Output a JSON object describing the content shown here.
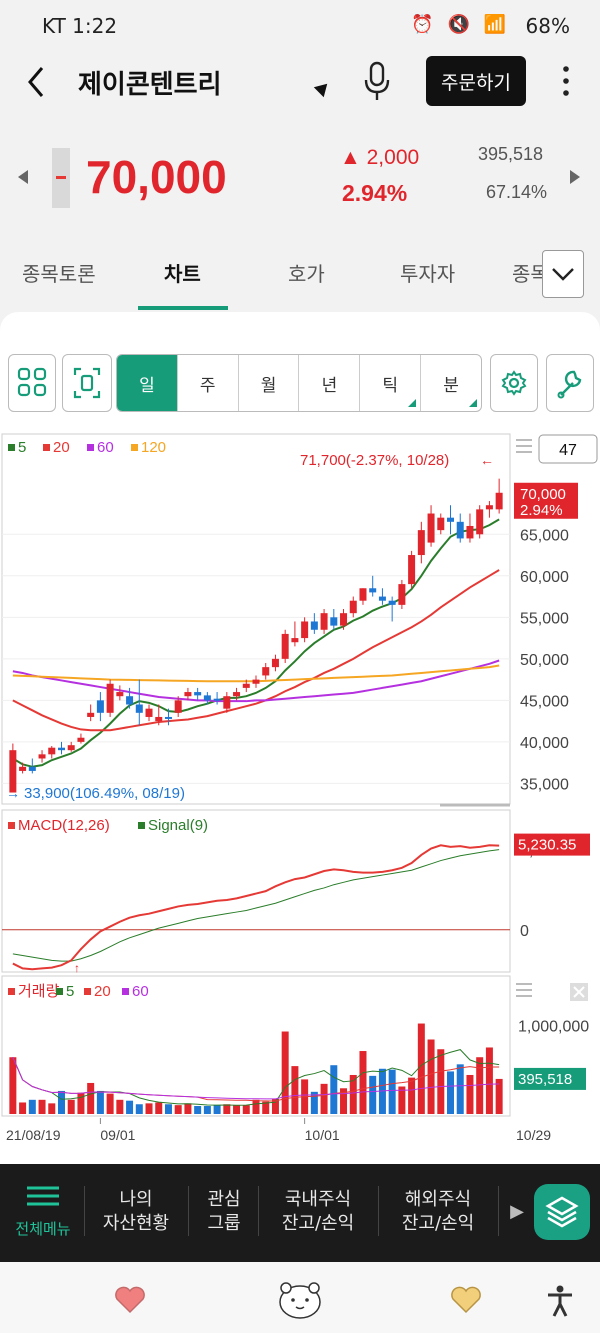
{
  "status": {
    "time": "KT 1:22",
    "battery": "68%"
  },
  "header": {
    "title": "제이콘텐트리",
    "order_label": "주문하기"
  },
  "quote": {
    "price": "70,000",
    "change": "2,000",
    "change_pct": "2.94%",
    "volume": "395,518",
    "turnover": "67.14%"
  },
  "tabs": [
    "종목토론",
    "차트",
    "호가",
    "투자자",
    "종목"
  ],
  "periods": [
    "일",
    "주",
    "월",
    "년",
    "틱",
    "분"
  ],
  "chart_data": [
    {
      "type": "line",
      "panel": "price",
      "legend": [
        "5",
        "20",
        "60",
        "120"
      ],
      "legend_colors": [
        "#2a7d2a",
        "#e53935",
        "#b531e0",
        "#f5a623"
      ],
      "y_ticks": [
        "35,000",
        "40,000",
        "45,000",
        "50,000",
        "55,000",
        "60,000",
        "65,000"
      ],
      "x_labels": [
        "21/08/19",
        "09/01",
        "10/01",
        "10/29"
      ],
      "ylim": [
        33000,
        72500
      ],
      "high_annotation": "71,700(-2.37%, 10/28)",
      "low_annotation": "33,900(106.49%, 08/19)",
      "current_price": "70,000",
      "current_pct": "2.94%",
      "visible_count": "47",
      "candles": [
        [
          33900,
          39800,
          36000,
          39000
        ],
        [
          36500,
          37500,
          36200,
          37000
        ],
        [
          37000,
          38000,
          36200,
          36500
        ],
        [
          38000,
          39000,
          37500,
          38500
        ],
        [
          38500,
          39500,
          38000,
          39300
        ],
        [
          39300,
          40000,
          38500,
          39000
        ],
        [
          39000,
          40000,
          38800,
          39600
        ],
        [
          40000,
          41000,
          39800,
          40500
        ],
        [
          43000,
          44500,
          42500,
          43500
        ],
        [
          45000,
          46000,
          42500,
          43500
        ],
        [
          43500,
          47500,
          43000,
          47000
        ],
        [
          45500,
          46800,
          45000,
          46000
        ],
        [
          45500,
          46500,
          44000,
          44500
        ],
        [
          44500,
          47500,
          42000,
          43500
        ],
        [
          43000,
          44500,
          42500,
          44000
        ],
        [
          42500,
          44500,
          42000,
          43000
        ],
        [
          43000,
          44000,
          42000,
          42800
        ],
        [
          43500,
          45500,
          43000,
          45000
        ],
        [
          45500,
          46500,
          45000,
          46000
        ],
        [
          46000,
          46500,
          45000,
          45600
        ],
        [
          45600,
          46000,
          44500,
          45000
        ],
        [
          45200,
          46000,
          44500,
          45000
        ],
        [
          44000,
          46000,
          43500,
          45500
        ],
        [
          45500,
          46500,
          45000,
          46000
        ],
        [
          46500,
          47500,
          46000,
          47000
        ],
        [
          47000,
          48000,
          46500,
          47500
        ],
        [
          48000,
          49500,
          47500,
          49000
        ],
        [
          49000,
          50500,
          48500,
          50000
        ],
        [
          50000,
          53500,
          49500,
          53000
        ],
        [
          52000,
          54500,
          51500,
          52500
        ],
        [
          52500,
          55000,
          52000,
          54500
        ],
        [
          54500,
          55500,
          53000,
          53500
        ],
        [
          53500,
          56000,
          53000,
          55500
        ],
        [
          55000,
          56000,
          53500,
          54000
        ],
        [
          54000,
          56000,
          53500,
          55500
        ],
        [
          55500,
          57500,
          55000,
          57000
        ],
        [
          57000,
          58500,
          56500,
          58500
        ],
        [
          58500,
          60000,
          57500,
          58000
        ],
        [
          57500,
          58500,
          56500,
          57000
        ],
        [
          57000,
          57500,
          54500,
          56500
        ],
        [
          56500,
          59500,
          56000,
          59000
        ],
        [
          59000,
          63000,
          58500,
          62500
        ],
        [
          62500,
          66500,
          61500,
          65500
        ],
        [
          64000,
          68500,
          63500,
          67500
        ],
        [
          65500,
          67500,
          65000,
          67000
        ],
        [
          67000,
          68500,
          65000,
          66500
        ],
        [
          66500,
          67500,
          64000,
          64500
        ],
        [
          64500,
          67500,
          64000,
          66000
        ],
        [
          65000,
          68500,
          64500,
          68000
        ],
        [
          68000,
          69000,
          67000,
          68500
        ],
        [
          68000,
          71700,
          67500,
          70000
        ]
      ],
      "ma": {
        "ma5": [
          38000,
          37300,
          37000,
          37200,
          37800,
          38200,
          38600,
          39200,
          40200,
          41100,
          42200,
          43400,
          44400,
          44900,
          44700,
          44300,
          43700,
          43600,
          43900,
          44300,
          44600,
          45000,
          45300,
          45300,
          45500,
          45900,
          46500,
          47300,
          48600,
          49700,
          50900,
          51900,
          52700,
          53500,
          53900,
          54600,
          55100,
          55800,
          56300,
          56700,
          57300,
          58400,
          60000,
          61800,
          63300,
          64700,
          65300,
          65500,
          65600,
          66100,
          66800
        ],
        "ma20": [
          45000,
          44400,
          43800,
          43200,
          42700,
          42200,
          41800,
          41500,
          41400,
          41400,
          41400,
          41600,
          41800,
          42000,
          42200,
          42400,
          42500,
          42600,
          42700,
          42900,
          43100,
          43400,
          43700,
          44000,
          44300,
          44600,
          45000,
          45500,
          46100,
          46600,
          47200,
          47700,
          48300,
          48800,
          49400,
          50000,
          50700,
          51400,
          52000,
          52600,
          53200,
          53800,
          54500,
          55300,
          56200,
          57000,
          57800,
          58600,
          59300,
          60000,
          60700
        ],
        "ma60": [
          48500,
          48300,
          48000,
          47800,
          47600,
          47400,
          47200,
          47000,
          46800,
          46600,
          46400,
          46200,
          46000,
          45800,
          45600,
          45400,
          45300,
          45200,
          45100,
          45000,
          45000,
          44900,
          44900,
          44900,
          44900,
          45000,
          45000,
          45100,
          45200,
          45300,
          45400,
          45500,
          45600,
          45700,
          45800,
          45900,
          46100,
          46300,
          46500,
          46700,
          46900,
          47100,
          47300,
          47600,
          47900,
          48200,
          48500,
          48800,
          49100,
          49400,
          49800
        ],
        "ma120": [
          48000,
          47950,
          47900,
          47850,
          47800,
          47750,
          47700,
          47650,
          47600,
          47550,
          47500,
          47480,
          47460,
          47440,
          47420,
          47400,
          47380,
          47360,
          47340,
          47320,
          47300,
          47300,
          47300,
          47300,
          47300,
          47300,
          47350,
          47400,
          47450,
          47500,
          47550,
          47600,
          47650,
          47700,
          47750,
          47800,
          47850,
          47900,
          47950,
          48000,
          48100,
          48200,
          48300,
          48400,
          48500,
          48600,
          48700,
          48800,
          48900,
          49000,
          49200
        ]
      }
    },
    {
      "type": "line",
      "panel": "macd",
      "legend": [
        "MACD(12,26)",
        "Signal(9)"
      ],
      "legend_colors": [
        "#e53935",
        "#2a7d2a"
      ],
      "y_ticks": [
        "5,000",
        "0"
      ],
      "ylim": [
        -2500,
        6200
      ],
      "current_value": "5,230.35",
      "macd": [
        -2100,
        -2400,
        -2450,
        -2400,
        -2350,
        -2200,
        -1900,
        -1200,
        -600,
        -100,
        200,
        500,
        750,
        900,
        1000,
        1150,
        1300,
        1450,
        1550,
        1600,
        1700,
        1800,
        1850,
        1950,
        2100,
        2250,
        2400,
        2700,
        2950,
        3150,
        3250,
        3450,
        3650,
        3750,
        3700,
        3600,
        3550,
        3550,
        3600,
        3700,
        3850,
        4150,
        4650,
        5050,
        5250,
        5150,
        5200,
        5100,
        5150,
        5250,
        5230
      ],
      "signal": [
        -1500,
        -1600,
        -1700,
        -1800,
        -1900,
        -1950,
        -1950,
        -1800,
        -1600,
        -1350,
        -1050,
        -750,
        -500,
        -300,
        -100,
        100,
        250,
        400,
        550,
        700,
        800,
        900,
        1000,
        1100,
        1200,
        1350,
        1500,
        1650,
        1850,
        2050,
        2250,
        2450,
        2600,
        2800,
        2950,
        3100,
        3200,
        3300,
        3400,
        3500,
        3600,
        3700,
        3900,
        4100,
        4300,
        4450,
        4600,
        4700,
        4800,
        4900,
        4980
      ]
    },
    {
      "type": "bar",
      "panel": "volume",
      "legend": [
        "거래량",
        "5",
        "20",
        "60"
      ],
      "legend_colors": [
        "#e53935",
        "#2a7d2a",
        "#e53935",
        "#b531e0"
      ],
      "y_ticks": [
        "1,000,000"
      ],
      "ylim": [
        0,
        1150000
      ],
      "current_value": "395,518",
      "volumes": [
        640000,
        130000,
        160000,
        160000,
        120000,
        260000,
        160000,
        240000,
        350000,
        260000,
        230000,
        160000,
        150000,
        110000,
        120000,
        130000,
        110000,
        100000,
        120000,
        90000,
        90000,
        100000,
        110000,
        100000,
        100000,
        160000,
        140000,
        170000,
        930000,
        540000,
        390000,
        250000,
        340000,
        550000,
        290000,
        440000,
        710000,
        430000,
        510000,
        500000,
        310000,
        410000,
        1020000,
        840000,
        730000,
        480000,
        560000,
        440000,
        640000,
        750000,
        395518
      ]
    }
  ],
  "bottom_nav": [
    "전체메뉴",
    "나의\n자산현황",
    "관심\n그룹",
    "국내주식\n잔고/손익",
    "해외주식\n잔고/손익"
  ]
}
